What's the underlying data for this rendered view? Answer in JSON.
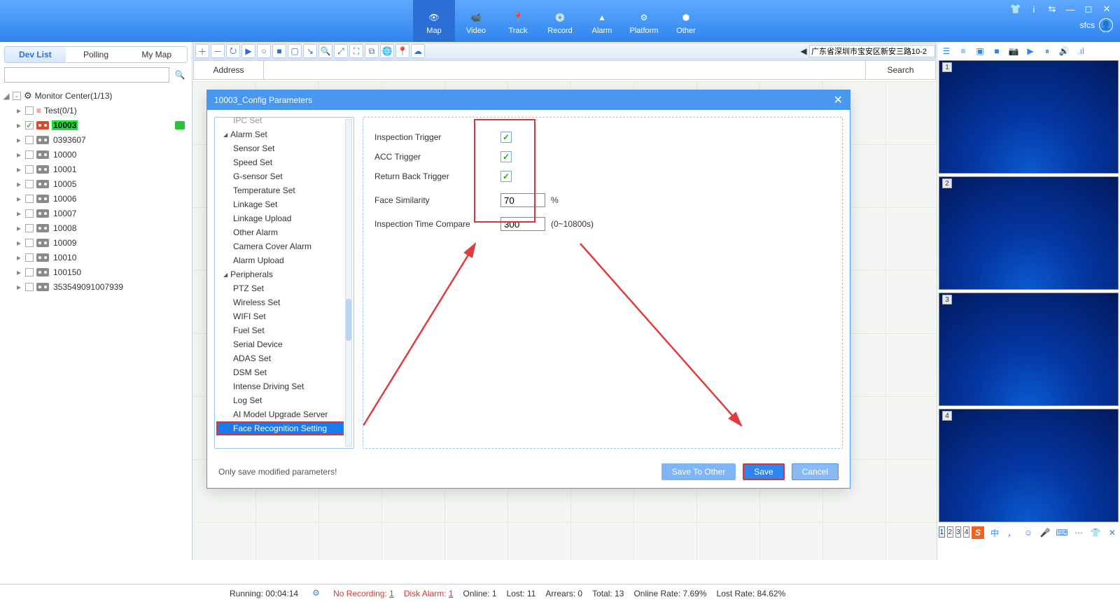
{
  "top": {
    "tabs": [
      "Map",
      "Video",
      "Track",
      "Record",
      "Alarm",
      "Platform",
      "Other"
    ],
    "active": 0,
    "user": "sfcs"
  },
  "sidebar": {
    "tabs": [
      "Dev List",
      "Polling",
      "My Map"
    ],
    "active": 0,
    "root": "Monitor Center(1/13)",
    "group": "Test(0/1)",
    "devices": [
      {
        "id": "10003",
        "online": true,
        "highlight": true,
        "chat": true
      },
      {
        "id": "0393607",
        "online": false
      },
      {
        "id": "10000",
        "online": false
      },
      {
        "id": "10001",
        "online": false
      },
      {
        "id": "10005",
        "online": false
      },
      {
        "id": "10006",
        "online": false
      },
      {
        "id": "10007",
        "online": false
      },
      {
        "id": "10008",
        "online": false
      },
      {
        "id": "10009",
        "online": false
      },
      {
        "id": "10010",
        "online": false
      },
      {
        "id": "100150",
        "online": false
      },
      {
        "id": "353549091007939",
        "online": false
      }
    ]
  },
  "maptoolbar": {
    "buttons": [
      "＋",
      "－",
      "⭮",
      "▶",
      "○",
      "■",
      "▢",
      "↘",
      "🔍",
      "⤢",
      "⛶",
      "⧉",
      "🌐",
      "📍",
      "☁"
    ],
    "address": "广东省深圳市宝安区新安三路10-2"
  },
  "addrbar": {
    "label": "Address",
    "search": "Search"
  },
  "rightpanel": {
    "icons": [
      "☰",
      "≡",
      "▣",
      "■",
      "📷",
      "▶",
      "⏸",
      "🔊",
      ".ıl"
    ],
    "tiles": [
      1,
      2,
      3,
      4
    ],
    "selector": [
      1,
      2,
      3,
      4
    ],
    "selected": 1,
    "ime": [
      "中",
      "，",
      "☺",
      "🎤",
      "⌨",
      "⋯",
      "👕",
      "✕"
    ]
  },
  "dialog": {
    "title": "10003_Config Parameters",
    "nav": {
      "top_cut": "IPC Set",
      "group1": "Alarm Set",
      "group1_items": [
        "Sensor Set",
        "Speed Set",
        "G-sensor Set",
        "Temperature Set",
        "Linkage Set",
        "Linkage Upload",
        "Other Alarm",
        "Camera Cover Alarm",
        "Alarm Upload"
      ],
      "group2": "Peripherals",
      "group2_items": [
        "PTZ Set",
        "Wireless Set",
        "WIFI Set",
        "Fuel Set",
        "Serial Device",
        "ADAS Set",
        "DSM Set",
        "Intense Driving Set",
        "Log Set",
        "AI Model Upgrade Server",
        "Face Recognition Setting"
      ],
      "selected": "Face Recognition Setting"
    },
    "form": {
      "rows": [
        {
          "label": "Inspection Trigger",
          "type": "check",
          "value": true
        },
        {
          "label": "ACC Trigger",
          "type": "check",
          "value": true
        },
        {
          "label": "Return Back Trigger",
          "type": "check",
          "value": true
        },
        {
          "label": "Face Similarity",
          "type": "num",
          "value": "70",
          "suffix": "%"
        },
        {
          "label": "Inspection Time Compare",
          "type": "num",
          "value": "300",
          "suffix": "(0~10800s)"
        }
      ]
    },
    "footer": {
      "hint": "Only save modified parameters!",
      "save_other": "Save To Other",
      "save": "Save",
      "cancel": "Cancel"
    }
  },
  "status": {
    "running_lbl": "Running:",
    "running_val": "00:04:14",
    "norec": "No Recording: ",
    "norec_n": "1",
    "disk": "Disk Alarm: ",
    "disk_n": "1",
    "online": "Online:  1",
    "lost": "Lost:  11",
    "arrears": "Arrears:  0",
    "total": "Total:  13",
    "orate": "Online Rate:  7.69%",
    "lrate": "Lost Rate:  84.62%"
  }
}
